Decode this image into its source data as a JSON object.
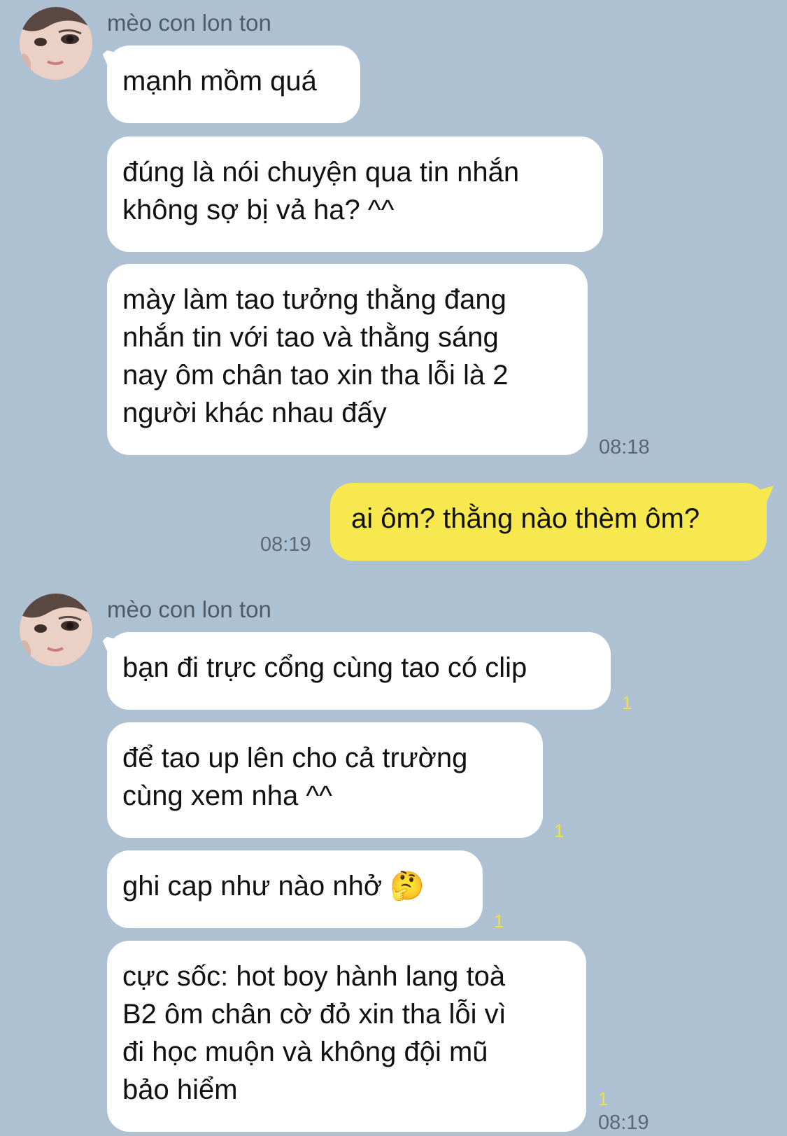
{
  "chat": {
    "groups": [
      {
        "sender": "mèo con lon ton",
        "messages": [
          {
            "text": "mạnh mồm quá"
          },
          {
            "text": "đúng là nói chuyện qua tin nhắn\nkhông sợ bị vả ha? ^^"
          },
          {
            "text": "mày làm tao tưởng thằng đang\nnhắn tin với tao và thằng sáng\nnay ôm chân tao xin tha lỗi là 2\nngười khác nhau đấy",
            "time": "08:18"
          }
        ]
      },
      {
        "outgoing": true,
        "messages": [
          {
            "text": "ai ôm? thằng nào thèm ôm?",
            "time": "08:19"
          }
        ]
      },
      {
        "sender": "mèo con lon ton",
        "messages": [
          {
            "text": "bạn đi trực cổng cùng tao có clip",
            "unread": "1"
          },
          {
            "text": "để tao up lên cho cả trường\ncùng xem nha ^^",
            "unread": "1"
          },
          {
            "text": "ghi cap như nào nhở 🤔",
            "unread": "1"
          },
          {
            "text": "cực sốc: hot boy hành lang toà\nB2 ôm chân cờ đỏ xin tha lỗi vì\nđi học muộn và không đội mũ\nbảo hiểm",
            "unread": "1",
            "time": "08:19"
          }
        ]
      }
    ]
  }
}
